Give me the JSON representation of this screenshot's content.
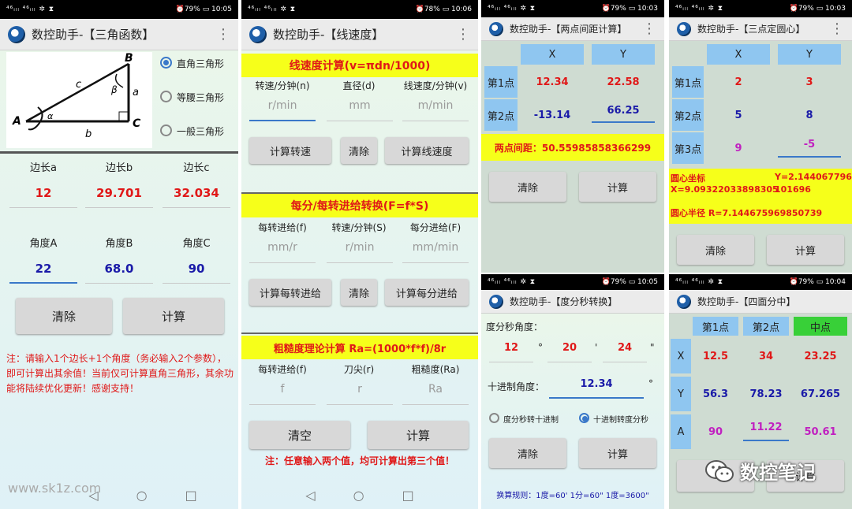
{
  "status": {
    "left": "⁴⁶ᵢₗₗ ⁴⁶ᵢₗₗ ✲ ⧗",
    "battery1": "⏰79% ▭ 10:05",
    "battery2": "⏰78% ▭ 10:06",
    "battery3": "⏰79% ▭ 10:03",
    "battery4": "⏰79% ▭ 10:03",
    "battery5": "⏰79% ▭ 10:05",
    "battery6": "⏰79% ▭ 10:04"
  },
  "menu_icon": "⋮",
  "s1": {
    "title": "数控助手-【三角函数】",
    "tri": {
      "B": "B",
      "c": "c",
      "beta": "β",
      "a": "a",
      "A": "A",
      "alpha": "α",
      "b": "b",
      "C": "C"
    },
    "radios": [
      "直角三角形",
      "等腰三角形",
      "一般三角形"
    ],
    "headers1": [
      "边长a",
      "边长b",
      "边长c"
    ],
    "values1": [
      "12",
      "29.701",
      "32.034"
    ],
    "headers2": [
      "角度A",
      "角度B",
      "角度C"
    ],
    "values2": [
      "22",
      "68.0",
      "90"
    ],
    "btn_clear": "清除",
    "btn_calc": "计算",
    "note": "注：请输入1个边长+1个角度（务必输入2个参数），即可计算出其余值！当前仅可计算直角三角形，其余功能将陆续优化更新！感谢支持！"
  },
  "s2": {
    "title": "数控助手-【线速度】",
    "sec1": "线速度计算(v=πdn/1000)",
    "sec1_labels": [
      "转速/分钟(n)",
      "直径(d)",
      "线速度/分钟(v)"
    ],
    "sec1_ph": [
      "r/min",
      "mm",
      "m/min"
    ],
    "sec1_btns": [
      "计算转速",
      "清除",
      "计算线速度"
    ],
    "sec2": "每分/每转进给转换(F=f*S)",
    "sec2_labels": [
      "每转进给(f)",
      "转速/分钟(S)",
      "每分进给(F)"
    ],
    "sec2_ph": [
      "mm/r",
      "r/min",
      "mm/min"
    ],
    "sec2_btns": [
      "计算每转进给",
      "清除",
      "计算每分进给"
    ],
    "sec3": "粗糙度理论计算 Ra=(1000*f*f)/8r",
    "sec3_labels": [
      "每转进给(f)",
      "刀尖(r)",
      "粗糙度(Ra)"
    ],
    "sec3_ph": [
      "f",
      "r",
      "Ra"
    ],
    "btn_clear": "清空",
    "btn_calc": "计算",
    "note": "注：任意输入两个值，均可计算出第三个值！"
  },
  "s3": {
    "title": "数控助手-【两点间距计算】",
    "col_x": "X",
    "col_y": "Y",
    "rows": [
      {
        "label": "第1点",
        "x": "12.34",
        "y": "22.58"
      },
      {
        "label": "第2点",
        "x": "-13.14",
        "y": "66.25"
      }
    ],
    "result": "两点间距：50.55985858366299",
    "btn_clear": "清除",
    "btn_calc": "计算"
  },
  "s4": {
    "title": "数控助手-【三点定圆心】",
    "col_x": "X",
    "col_y": "Y",
    "rows": [
      {
        "label": "第1点",
        "x": "2",
        "y": "3"
      },
      {
        "label": "第2点",
        "x": "5",
        "y": "8"
      },
      {
        "label": "第3点",
        "x": "9",
        "y": "-5"
      }
    ],
    "center_label": "圆心坐标",
    "center_x": "X=9.09322033898305",
    "center_y1": "Y=2.1440677966",
    "center_y2": "101696",
    "radius": "圆心半径 R=7.144675969850739",
    "btn_clear": "清除",
    "btn_calc": "计算"
  },
  "s5": {
    "title": "数控助手-【度分秒转换】",
    "dms_label": "度分秒角度：",
    "deg": "12",
    "deg_sym": "°",
    "min": "20",
    "min_sym": "'",
    "sec": "24",
    "sec_sym": "\"",
    "dec_label": "十进制角度：",
    "dec": "12.34",
    "dec_sym": "°",
    "radio1": "度分秒转十进制",
    "radio2": "十进制转度分秒",
    "btn_clear": "清除",
    "btn_calc": "计算",
    "rule": "换算规则：1度=60' 1分=60\" 1度=3600\""
  },
  "s6": {
    "title": "数控助手-【四面分中】",
    "cols": [
      "第1点",
      "第2点",
      "中点"
    ],
    "rows": [
      {
        "label": "X",
        "v": [
          "12.5",
          "34",
          "23.25"
        ]
      },
      {
        "label": "Y",
        "v": [
          "56.3",
          "78.23",
          "67.265"
        ]
      },
      {
        "label": "A",
        "v": [
          "90",
          "11.22",
          "50.61"
        ]
      }
    ],
    "btn_calc": "计算"
  },
  "watermark": "www.sk1z.com",
  "wechat": "数控笔记",
  "nav": {
    "back": "◁",
    "home": "○",
    "recent": "□"
  }
}
